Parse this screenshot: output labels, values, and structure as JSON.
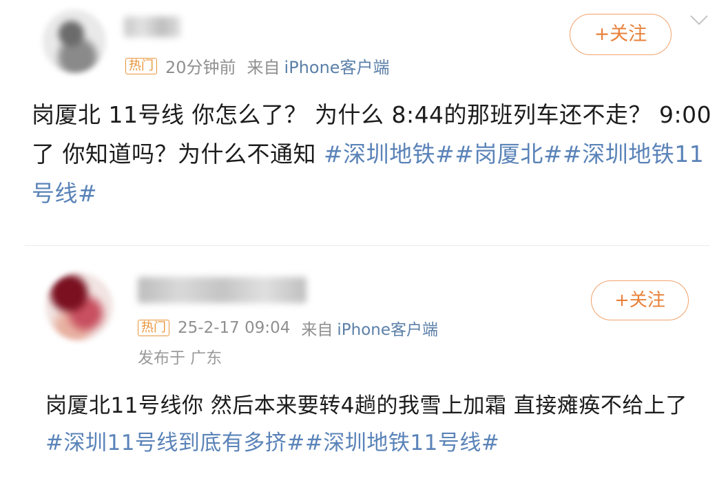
{
  "post1": {
    "badge": "热门",
    "time": "20分钟前",
    "source_prefix": "来自",
    "client": "iPhone客户端",
    "follow_label": "+关注",
    "text": "岗厦北 11号线 你怎么了？ 为什么 8:44的那班列车还不走？ 9:00了 你知道吗？为什么不通知 ",
    "topics": "#深圳地铁##岗厦北##深圳地铁11号线#"
  },
  "post2": {
    "badge": "热门",
    "time": "25-2-17 09:04",
    "source_prefix": "来自",
    "client": "iPhone客户端",
    "location": "发布于 广东",
    "follow_label": "+关注",
    "text": "岗厦北11号线你 然后本来要转4趟的我雪上加霜 直接瘫痪不给上了 ",
    "topics": "#深圳11号线到底有多挤##深圳地铁11号线#"
  },
  "icons": {
    "avatar": "avatar-blurred",
    "expand": "chevron-down-icon"
  },
  "colors": {
    "accent": "#e8813a",
    "topic": "#5a83b8",
    "meta": "#8f8f8f"
  }
}
